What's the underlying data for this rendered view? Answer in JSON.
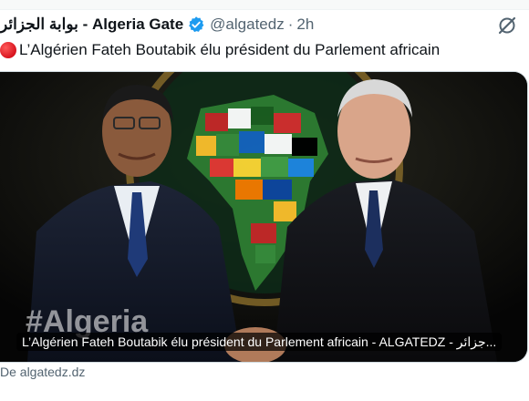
{
  "tweet": {
    "display_name": "بوابة الجزائر - Algeria Gate",
    "handle": "@algatedz",
    "separator": "·",
    "time": "2h",
    "text": "L’Algérien Fateh Boutabik élu président du Parlement africain",
    "emoji_icon": "red-circle-icon",
    "verified_icon": "verified-badge-icon",
    "grok_icon": "grok-icon"
  },
  "card": {
    "caption": "L’Algérien Fateh Boutabik élu président du Parlement africain - ALGATEDZ - جزائر...",
    "watermark": "#Algeria",
    "source": "De algatedz.dz"
  },
  "colors": {
    "text": "#0f1419",
    "secondary": "#536471",
    "verified_blue": "#1d9bf0",
    "border": "#cfd9de"
  }
}
